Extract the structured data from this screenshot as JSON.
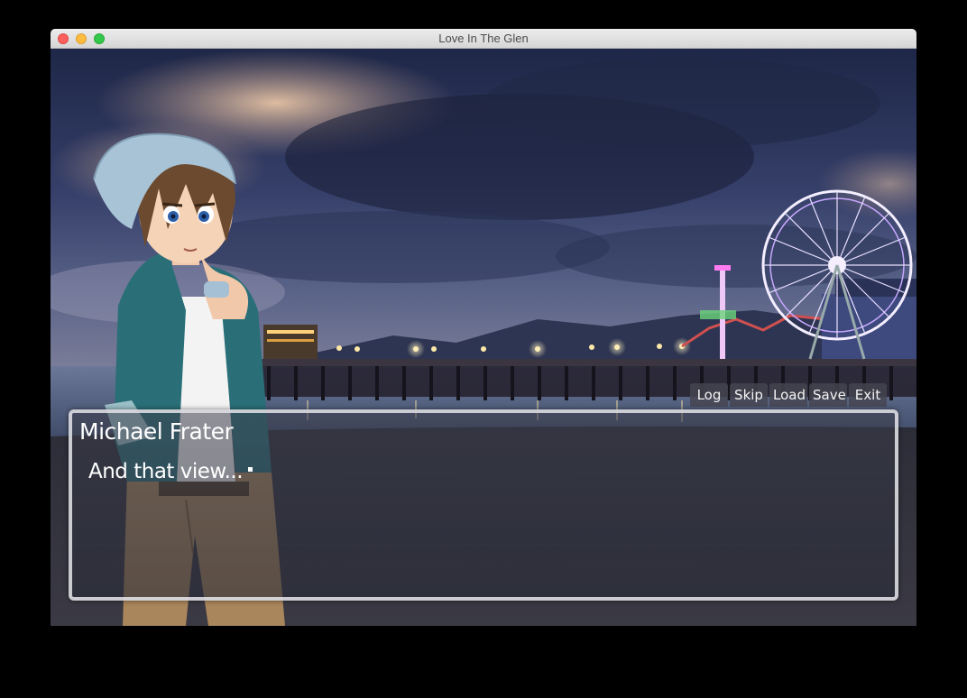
{
  "window": {
    "title": "Love In The Glen"
  },
  "dialogue": {
    "speaker": "Michael Frater",
    "line": "And that view..."
  },
  "quick_menu": {
    "log": "Log",
    "skip": "Skip",
    "load": "Load",
    "save": "Save",
    "exit": "Exit"
  },
  "colors": {
    "sky_dark": "#1c2440",
    "sky_mid": "#3a4670",
    "cloud_warm": "#d9b79a",
    "sea": "#3c4a66",
    "sand": "#2a2a33",
    "pier_light": "#ffe9a8",
    "ferris_wheel": "#e9e3ff",
    "hat": "#a9c3d6",
    "hair": "#6b4a30",
    "shirt": "#2a6f78",
    "pants": "#a07c55"
  }
}
